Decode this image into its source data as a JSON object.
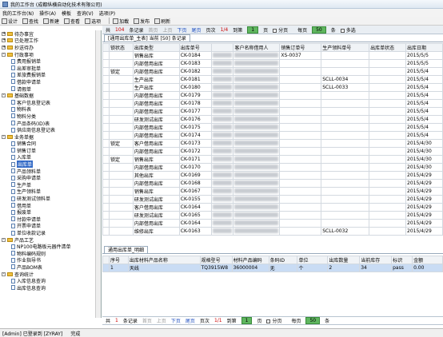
{
  "window": {
    "title": "我的工作台 (成都纵横自动化技术有限公司)"
  },
  "menu": [
    "我的工作台(N)",
    "操作(A)",
    "模板",
    "查询(V)",
    "选项(P)"
  ],
  "toolbar": [
    {
      "label": "设计",
      "icon": "design-icon"
    },
    {
      "label": "查找",
      "icon": "find-icon"
    },
    {
      "label": "新建",
      "icon": "new-icon"
    },
    {
      "label": "查看",
      "icon": "view-icon"
    },
    {
      "label": "选项",
      "icon": "options-icon"
    },
    {
      "label": "加載",
      "icon": "load-icon"
    },
    {
      "label": "发布",
      "icon": "publish-icon"
    },
    {
      "label": "刷新",
      "icon": "refresh-icon"
    }
  ],
  "sidebar": {
    "items": [
      {
        "label": "待办事宜",
        "level": 0,
        "type": "folder",
        "toggle": "+"
      },
      {
        "label": "已处理工作",
        "level": 0,
        "type": "folder",
        "toggle": "+"
      },
      {
        "label": "抄送待办",
        "level": 0,
        "type": "folder",
        "toggle": "+"
      },
      {
        "label": "行政事项",
        "level": 0,
        "type": "folder",
        "toggle": "-"
      },
      {
        "label": "费用报销单",
        "level": 1,
        "type": "doc"
      },
      {
        "label": "出差审批单",
        "level": 1,
        "type": "doc"
      },
      {
        "label": "差旅费报销单",
        "level": 1,
        "type": "doc"
      },
      {
        "label": "借款申请单",
        "level": 1,
        "type": "doc"
      },
      {
        "label": "请假单",
        "level": 1,
        "type": "doc"
      },
      {
        "label": "基础数据",
        "level": 0,
        "type": "folder",
        "toggle": "-"
      },
      {
        "label": "客户信息登记表",
        "level": 1,
        "type": "doc"
      },
      {
        "label": "物料表",
        "level": 1,
        "type": "doc"
      },
      {
        "label": "物料分类",
        "level": 1,
        "type": "doc"
      },
      {
        "label": "产品条码(ID)表",
        "level": 1,
        "type": "doc"
      },
      {
        "label": "供应商信息登记表",
        "level": 1,
        "type": "doc"
      },
      {
        "label": "业务单据",
        "level": 0,
        "type": "folder",
        "toggle": "-"
      },
      {
        "label": "销售合同",
        "level": 1,
        "type": "doc"
      },
      {
        "label": "销售订单",
        "level": 1,
        "type": "doc"
      },
      {
        "label": "入库单",
        "level": 1,
        "type": "doc"
      },
      {
        "label": "出库单",
        "level": 1,
        "type": "doc",
        "selected": true
      },
      {
        "label": "产品领料单",
        "level": 1,
        "type": "doc"
      },
      {
        "label": "采购申请单",
        "level": 1,
        "type": "doc"
      },
      {
        "label": "生产单",
        "level": 1,
        "type": "doc"
      },
      {
        "label": "生产领料单",
        "level": 1,
        "type": "doc"
      },
      {
        "label": "研发测试领料单",
        "level": 1,
        "type": "doc"
      },
      {
        "label": "借用单",
        "level": 1,
        "type": "doc"
      },
      {
        "label": "报废单",
        "level": 1,
        "type": "doc"
      },
      {
        "label": "付款申请单",
        "level": 1,
        "type": "doc"
      },
      {
        "label": "开票申请单",
        "level": 1,
        "type": "doc"
      },
      {
        "label": "单位收款记录",
        "level": 1,
        "type": "doc"
      },
      {
        "label": "产品工艺",
        "level": 0,
        "type": "folder",
        "toggle": "-"
      },
      {
        "label": "NP100电路板元器件清单",
        "level": 1,
        "type": "doc"
      },
      {
        "label": "物料编码规则",
        "level": 1,
        "type": "doc"
      },
      {
        "label": "作业指导书",
        "level": 1,
        "type": "doc"
      },
      {
        "label": "产品BOM表",
        "level": 1,
        "type": "doc"
      },
      {
        "label": "查询统计",
        "level": 0,
        "type": "folder",
        "toggle": "-"
      },
      {
        "label": "入库信息查询",
        "level": 1,
        "type": "doc"
      },
      {
        "label": "出库信息查询",
        "level": 1,
        "type": "doc"
      }
    ]
  },
  "pager_top": {
    "total_prefix": "共",
    "total": "104",
    "total_suffix": "条记录",
    "first": "首页",
    "prev": "上页",
    "next": "下页",
    "last": "尾页",
    "pages_label": "页次",
    "pages": "1/4",
    "goto_label": "到第",
    "goto_value": "1",
    "page_unit": "页",
    "pagesize_check": "分页",
    "per_page_label": "每页",
    "per_page": "50",
    "per_page_unit": "条",
    "multi": "多选"
  },
  "tab_top": "[通用出库单_主表]  当前 [50] 条记录",
  "main_grid": {
    "columns": [
      "",
      "锁状态",
      "出库类型",
      "出库单号",
      "",
      "客户名称借用人",
      "销售订单号",
      "生产领料单号",
      "出库单状态",
      "出库日期"
    ],
    "rows": [
      [
        "",
        "",
        "销售出库",
        "CK-0184",
        "",
        "",
        "XS-0037",
        "",
        "",
        "2015/5/5"
      ],
      [
        "",
        "",
        "内部借用出库",
        "CK-0183",
        "",
        "",
        "",
        "",
        "",
        "2015/5/5"
      ],
      [
        "",
        "锁定",
        "内部借用出库",
        "CK-0182",
        "",
        "",
        "",
        "",
        "",
        "2015/5/4"
      ],
      [
        "",
        "",
        "生产出库",
        "CK-0181",
        "",
        "",
        "",
        "SCLL-0034",
        "",
        "2015/5/4"
      ],
      [
        "",
        "",
        "生产出库",
        "CK-0180",
        "",
        "",
        "",
        "SCLL-0033",
        "",
        "2015/5/4"
      ],
      [
        "",
        "",
        "内部借用出库",
        "CK-0179",
        "",
        "",
        "",
        "",
        "",
        "2015/5/4"
      ],
      [
        "",
        "",
        "内部借用出库",
        "CK-0178",
        "",
        "",
        "",
        "",
        "",
        "2015/5/4"
      ],
      [
        "",
        "",
        "内部借用出库",
        "CK-0177",
        "",
        "",
        "",
        "",
        "",
        "2015/5/4"
      ],
      [
        "",
        "",
        "研发测试出库",
        "CK-0176",
        "",
        "",
        "",
        "",
        "",
        "2015/5/4"
      ],
      [
        "",
        "",
        "内部借用出库",
        "CK-0175",
        "",
        "",
        "",
        "",
        "",
        "2015/5/4"
      ],
      [
        "",
        "",
        "内部借用出库",
        "CK-0174",
        "",
        "",
        "",
        "",
        "",
        "2015/5/4"
      ],
      [
        "",
        "锁定",
        "客户借用出库",
        "CK-0173",
        "",
        "",
        "",
        "",
        "",
        "2015/4/30"
      ],
      [
        "",
        "",
        "内部借用出库",
        "CK-0172",
        "",
        "",
        "",
        "",
        "",
        "2015/4/30"
      ],
      [
        "",
        "锁定",
        "销售出库",
        "CK-0171",
        "",
        "",
        "",
        "",
        "",
        "2015/4/30"
      ],
      [
        "",
        "",
        "内部借用出库",
        "CK-0170",
        "",
        "",
        "",
        "",
        "",
        "2015/4/30"
      ],
      [
        "",
        "",
        "其他出库",
        "CK-0169",
        "",
        "",
        "",
        "",
        "",
        "2015/4/29"
      ],
      [
        "",
        "",
        "内部借用出库",
        "CK-0168",
        "",
        "",
        "",
        "",
        "",
        "2015/4/29"
      ],
      [
        "",
        "",
        "销售出库",
        "CK-0167",
        "",
        "",
        "",
        "",
        "",
        "2015/4/29"
      ],
      [
        "",
        "",
        "研发测试出库",
        "CK-0155",
        "",
        "",
        "",
        "",
        "",
        "2015/4/29"
      ],
      [
        "",
        "",
        "客户借用出库",
        "CK-0164",
        "",
        "",
        "",
        "",
        "",
        "2015/4/29"
      ],
      [
        "",
        "",
        "研发测试出库",
        "CK-0165",
        "",
        "",
        "",
        "",
        "",
        "2015/4/29"
      ],
      [
        "",
        "",
        "内部借用出库",
        "CK-0164",
        "",
        "",
        "",
        "",
        "",
        "2015/4/29"
      ],
      [
        "",
        "",
        "维修出库",
        "CK-0163",
        "",
        "",
        "",
        "SCLL-0032",
        "",
        "2015/4/29"
      ]
    ]
  },
  "tab_bottom": "通用出库单_明细",
  "detail_grid": {
    "columns": [
      "",
      "序号",
      "出库材料产品名称",
      "规格型号",
      "材料产品编码",
      "条码ID",
      "单位",
      "出库数量",
      "当前库存",
      "标识",
      "金额"
    ],
    "rows": [
      [
        "",
        "1",
        "天线",
        "TQ3915W8",
        "36000004",
        "无",
        "个",
        "2",
        "34",
        "pass",
        "0.00"
      ]
    ]
  },
  "pager_bottom": {
    "total_prefix": "共",
    "total": "1",
    "total_suffix": "条记录",
    "first": "首页",
    "prev": "上页",
    "next": "下页",
    "last": "尾页",
    "pages_label": "页次",
    "pages": "1/1",
    "goto_label": "到第",
    "goto_value": "1",
    "page_unit": "页",
    "pagesize_check": "分页",
    "per_page_label": "每页",
    "per_page": "50",
    "per_page_unit": "条"
  },
  "statusbar": [
    "[Admin] 已登录到 [ZYRAY]",
    "完成"
  ]
}
